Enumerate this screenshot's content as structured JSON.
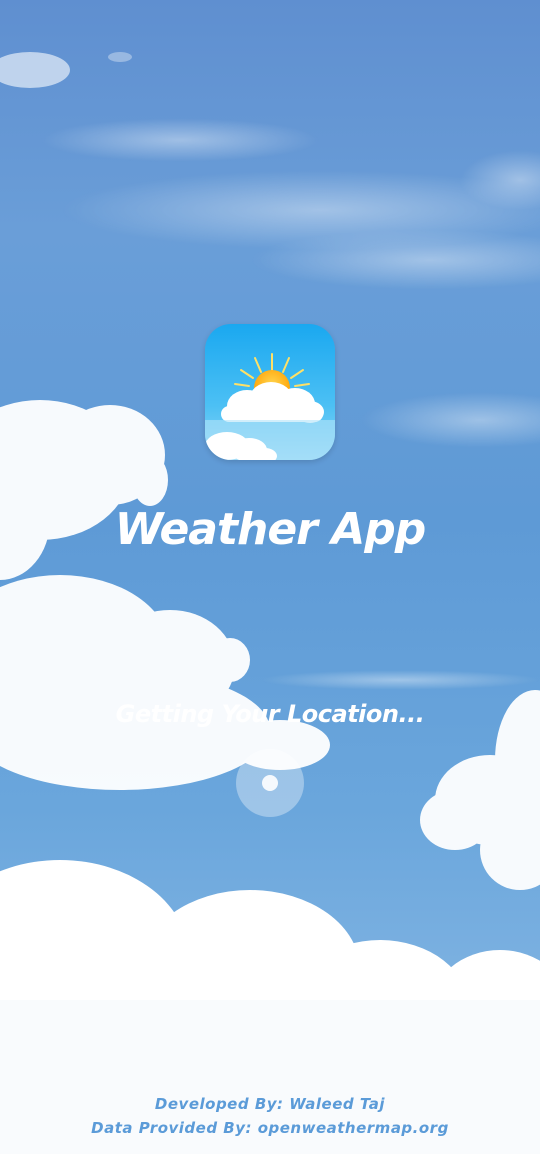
{
  "splash": {
    "app_name": "Weather App",
    "status": "Getting Your Location...",
    "app_icon": "sun-cloud-icon",
    "loading_indicator": "spinner-icon"
  },
  "footer": {
    "developer": "Developed By: Waleed Taj",
    "data_source": "Data Provided By: openweathermap.org"
  },
  "colors": {
    "sky": "#5e9ad6",
    "title_text": "#ffffff",
    "footer_text": "#5b9bd8",
    "icon_sun": "#ffb300",
    "icon_sky": "#29b6f6"
  }
}
